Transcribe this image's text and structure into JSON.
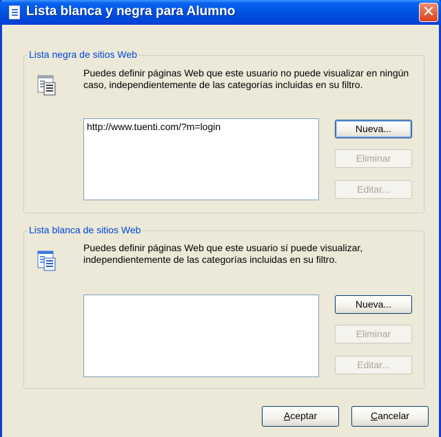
{
  "window": {
    "title": "Lista blanca y negra para  Alumno",
    "close_symbol": "✕"
  },
  "blacklist": {
    "legend": "Lista negra de sitios Web",
    "description": "Puedes definir páginas Web que este usuario no puede visualizar en ningún caso, independientemente de las categorías incluidas en su filtro.",
    "icon": "web-page-list-icon",
    "items": [
      "http://www.tuenti.com/?m=login"
    ],
    "buttons": {
      "new": "Nueva...",
      "delete": "Eliminar",
      "edit": "Editar..."
    }
  },
  "whitelist": {
    "legend": "Lista blanca de sitios Web",
    "description": "Puedes definir páginas Web que este usuario sí puede visualizar, independientemente de las categorías incluidas en su filtro.",
    "icon": "web-page-list-icon",
    "items": [],
    "buttons": {
      "new": "Nueva...",
      "delete": "Eliminar",
      "edit": "Editar..."
    }
  },
  "footer": {
    "accept_first": "A",
    "accept_rest": "ceptar",
    "cancel_first": "C",
    "cancel_rest": "ancelar"
  },
  "colors": {
    "titlebar": "#0055e5",
    "legend": "#0046d5",
    "close": "#d9431e"
  }
}
